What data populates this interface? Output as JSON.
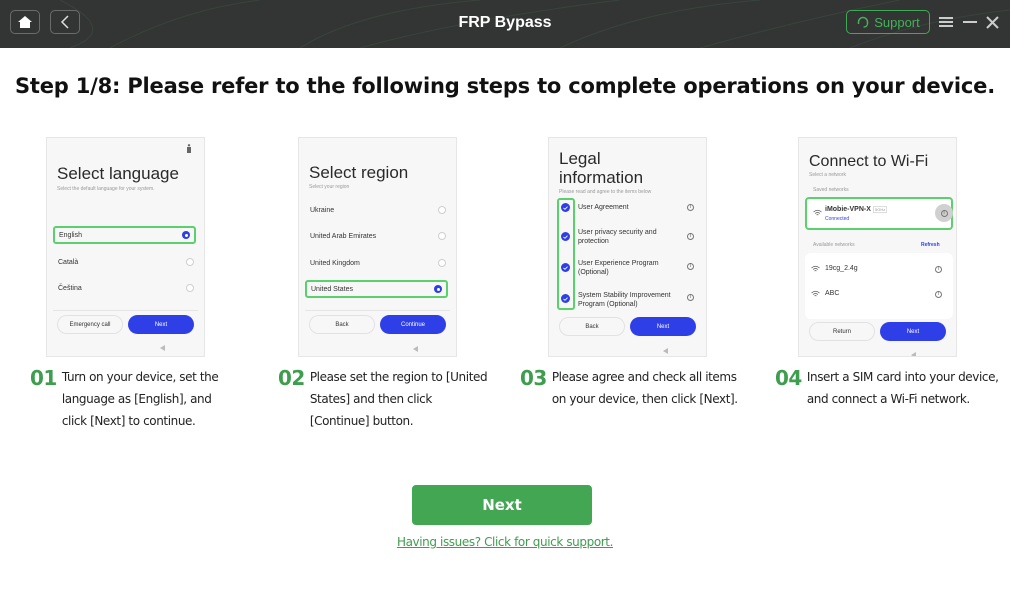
{
  "titlebar": {
    "title": "FRP Bypass",
    "home_icon": "home-icon",
    "back_icon": "chevron-left-icon",
    "support_label": "Support",
    "support_icon": "headset-icon",
    "menu_icon": "hamburger-menu-icon",
    "minimize_icon": "minimize-icon",
    "close_icon": "close-icon"
  },
  "heading": "Step 1/8: Please refer to the following steps to complete operations on your device.",
  "phones": {
    "language": {
      "title": "Select language",
      "subtitle": "Select the default language for your system.",
      "items": [
        {
          "label": "English",
          "selected": true
        },
        {
          "label": "Català",
          "selected": false
        },
        {
          "label": "Čeština",
          "selected": false
        }
      ],
      "secondary_button": "Emergency call",
      "primary_button": "Next"
    },
    "region": {
      "title": "Select region",
      "subtitle": "Select your region",
      "items": [
        {
          "label": "Ukraine",
          "selected": false
        },
        {
          "label": "United Arab Emirates",
          "selected": false
        },
        {
          "label": "United Kingdom",
          "selected": false
        },
        {
          "label": "United States",
          "selected": true
        }
      ],
      "secondary_button": "Back",
      "primary_button": "Continue"
    },
    "legal": {
      "title_line1": "Legal",
      "title_line2": "information",
      "subtitle": "Please read and agree to the items below",
      "items": [
        {
          "label_line1": "User Agreement",
          "label_line2": "",
          "checked": true
        },
        {
          "label_line1": "User privacy security and",
          "label_line2": "protection",
          "checked": true
        },
        {
          "label_line1": "User Experience Program",
          "label_line2": "(Optional)",
          "checked": true
        },
        {
          "label_line1": "System Stability Improvement",
          "label_line2": "Program (Optional)",
          "checked": true
        }
      ],
      "secondary_button": "Back",
      "primary_button": "Next"
    },
    "wifi": {
      "title": "Connect to Wi-Fi",
      "subtitle": "Select a network",
      "saved_label": "Saved networks",
      "saved_network": {
        "name": "iMobie-VPN-X",
        "band": "5GHz",
        "status": "Connected"
      },
      "available_label": "Available networks",
      "refresh_label": "Refresh",
      "networks": [
        "19cg_2.4g",
        "ABC"
      ],
      "secondary_button": "Return",
      "primary_button": "Next"
    }
  },
  "steps": [
    {
      "num": "01",
      "text": "Turn on your device, set the language as [English], and click [Next] to continue."
    },
    {
      "num": "02",
      "text": "Please set the region to [United States] and then click [Continue] button."
    },
    {
      "num": "03",
      "text": "Please agree and check all items on your device, then click [Next]."
    },
    {
      "num": "04",
      "text": "Insert a SIM card into your device, and connect a Wi-Fi network."
    }
  ],
  "next_button": "Next",
  "help_link": "Having issues? Click for quick support.",
  "colors": {
    "titlebar_bg": "#333534",
    "accent_green": "#42a652",
    "phone_blue": "#2e3fe8",
    "highlight_green": "#5bd16e"
  }
}
